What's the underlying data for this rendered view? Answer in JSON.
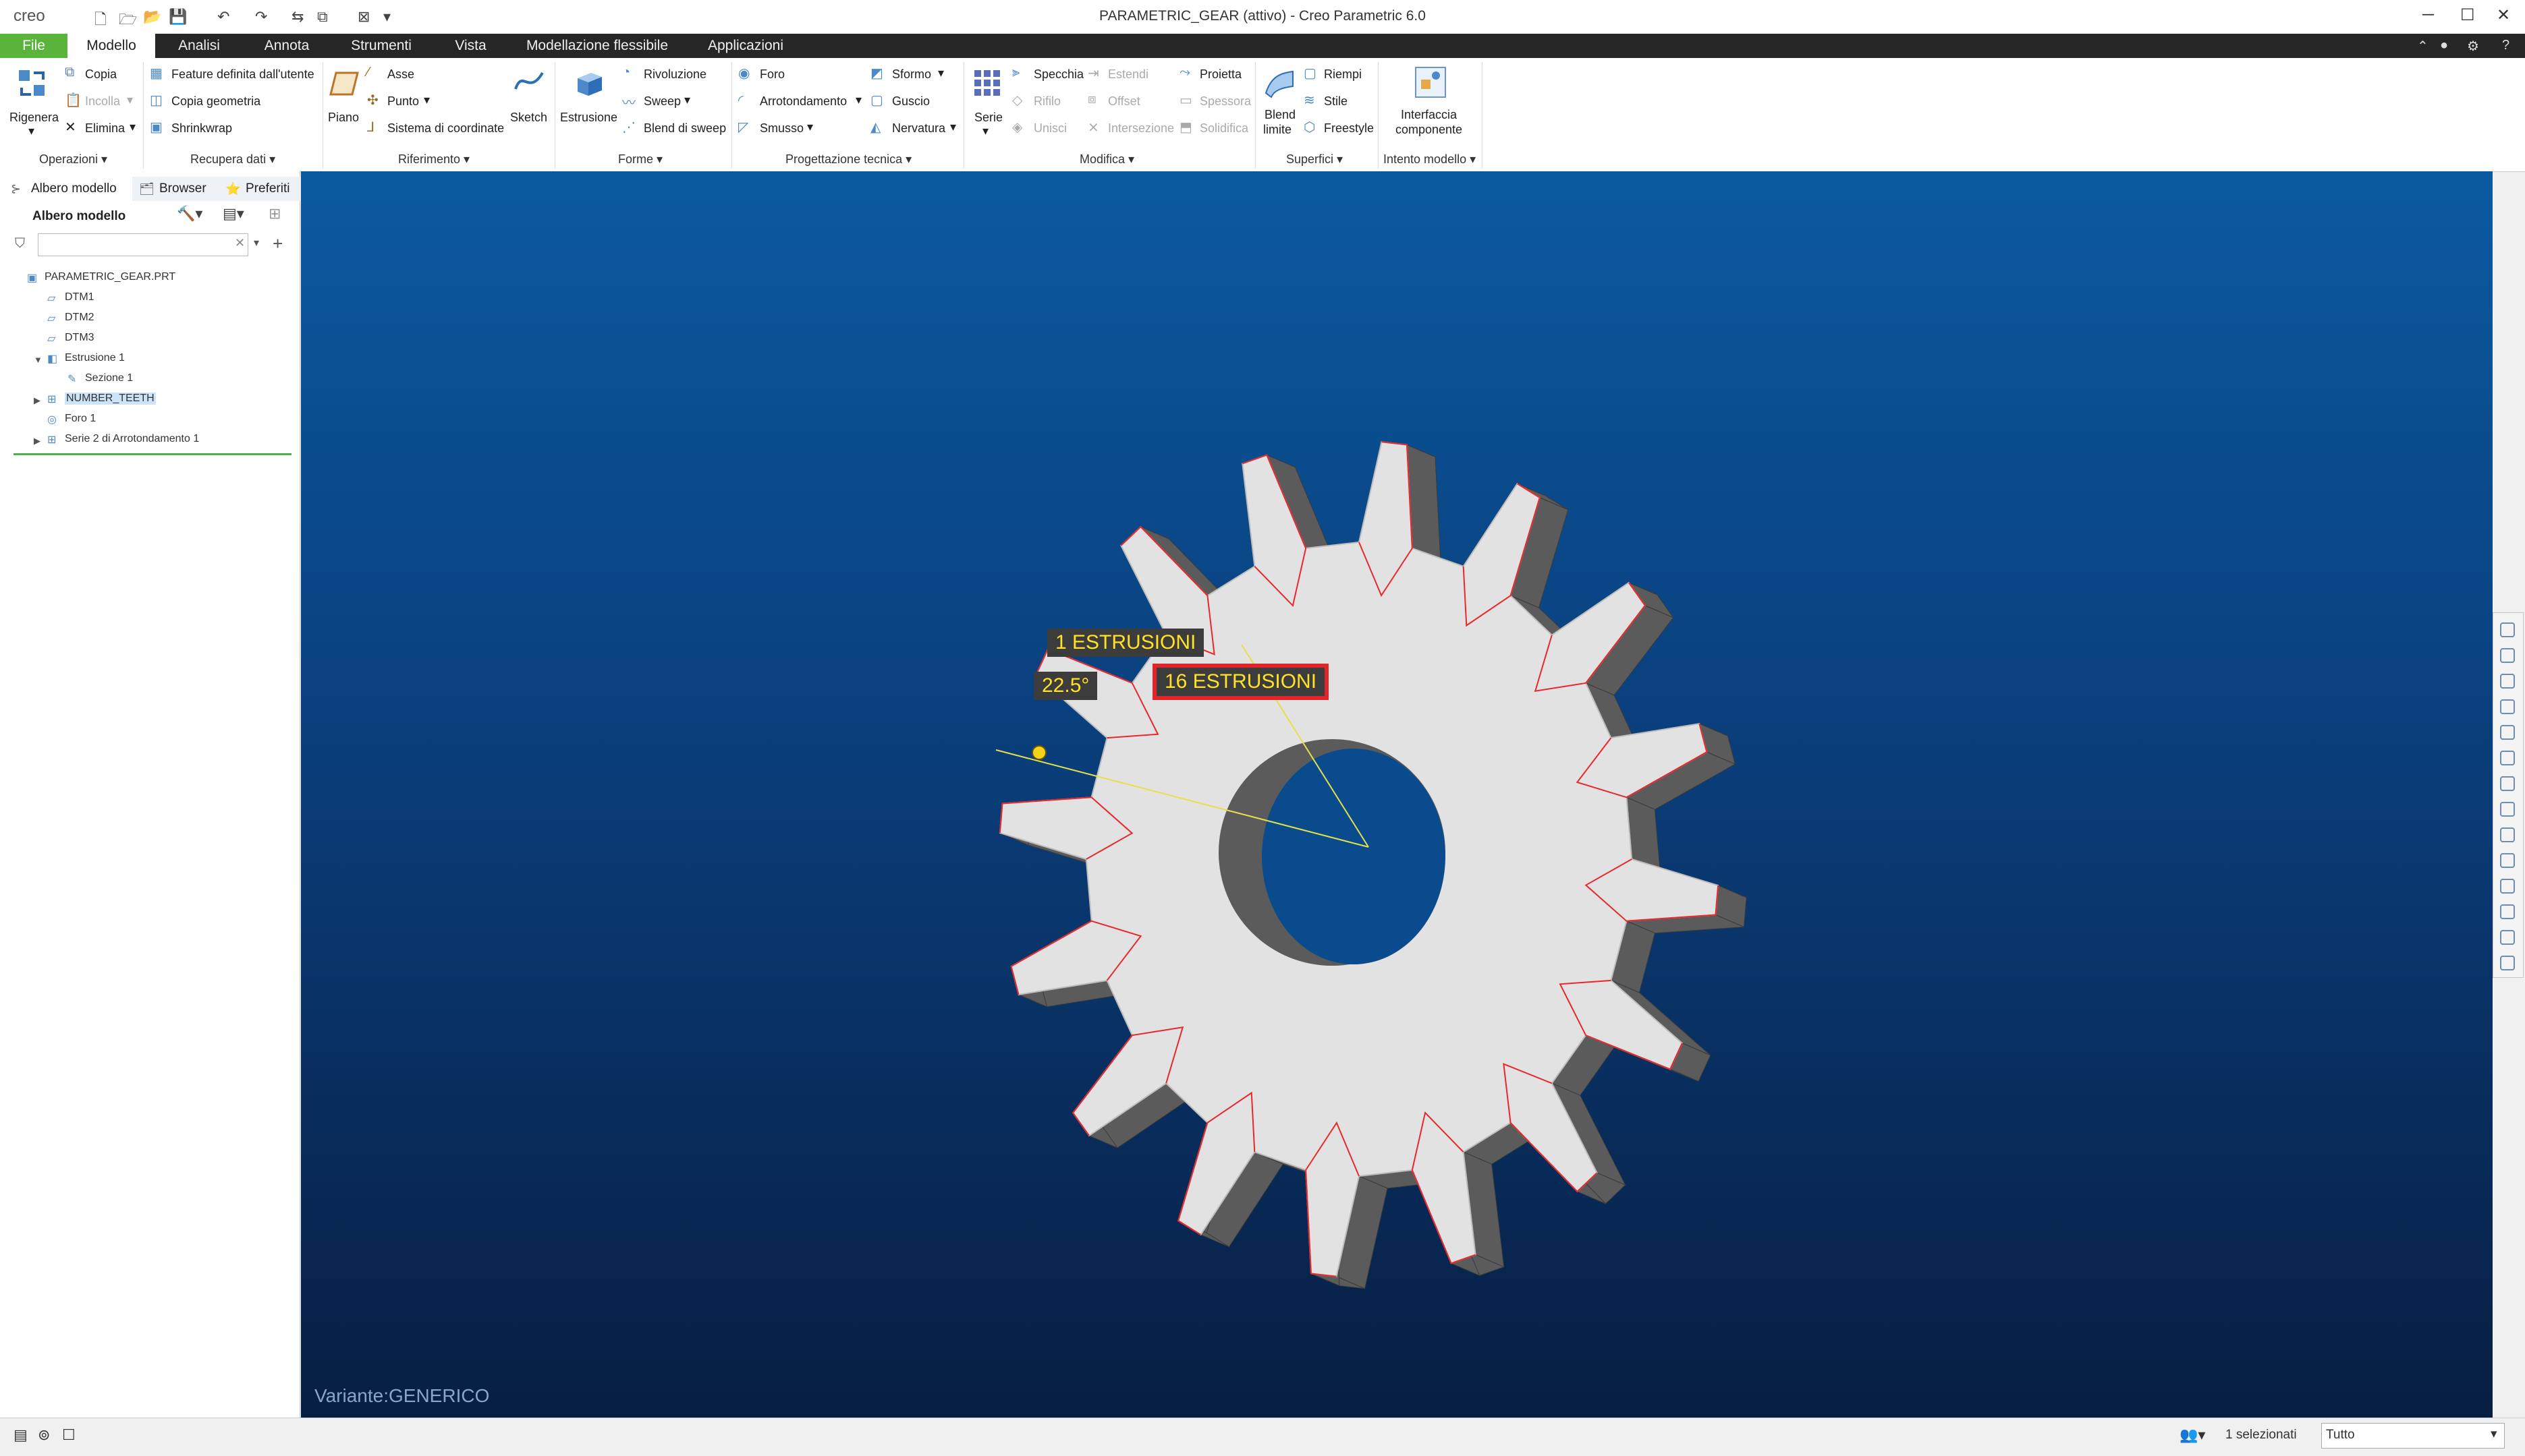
{
  "app": {
    "logo": "creo",
    "title": "PARAMETRIC_GEAR (attivo) - Creo Parametric 6.0"
  },
  "quick_access": [
    "new-icon",
    "open-icon",
    "folder-icon",
    "save-icon",
    "undo-icon",
    "redo-icon",
    "regenerate-icon",
    "window-icon",
    "close-window-icon",
    "customize-icon"
  ],
  "window_controls": [
    "minimize-icon",
    "maximize-icon",
    "close-icon"
  ],
  "menu": {
    "tabs": [
      "File",
      "Modello",
      "Analisi",
      "Annota",
      "Strumenti",
      "Vista",
      "Modellazione flessibile",
      "Applicazioni"
    ],
    "active": "Modello"
  },
  "ribbon": {
    "operazioni": {
      "rigenera": "Rigenera",
      "copia": "Copia",
      "incolla": "Incolla",
      "elimina": "Elimina",
      "group": "Operazioni"
    },
    "recupera": {
      "udf": "Feature definita dall'utente",
      "copia_geom": "Copia geometria",
      "shrinkwrap": "Shrinkwrap",
      "group": "Recupera dati"
    },
    "riferimento": {
      "piano": "Piano",
      "asse": "Asse",
      "punto": "Punto",
      "sistema": "Sistema di coordinate",
      "sketch": "Sketch",
      "group": "Riferimento"
    },
    "forme": {
      "estrusione": "Estrusione",
      "rivoluzione": "Rivoluzione",
      "sweep": "Sweep",
      "blend_sweep": "Blend di sweep",
      "group": "Forme"
    },
    "progettazione": {
      "foro": "Foro",
      "arrotondamento": "Arrotondamento",
      "smusso": "Smusso",
      "sformo": "Sformo",
      "guscio": "Guscio",
      "nervatura": "Nervatura",
      "group": "Progettazione tecnica"
    },
    "modifica": {
      "serie": "Serie",
      "specchia": "Specchia",
      "estendi": "Estendi",
      "proietta": "Proietta",
      "rifilo": "Rifilo",
      "offset": "Offset",
      "spessora": "Spessora",
      "unisci": "Unisci",
      "intersezione": "Intersezione",
      "solidifica": "Solidifica",
      "group": "Modifica"
    },
    "superfici": {
      "blend": "Blend",
      "limite": "limite",
      "riempi": "Riempi",
      "stile": "Stile",
      "freestyle": "Freestyle",
      "group": "Superfici"
    },
    "intento": {
      "interfaccia": "Interfaccia",
      "componente": "componente",
      "group": "Intento modello"
    }
  },
  "panel": {
    "tabs": [
      "Albero modello",
      "Browser",
      "Preferiti"
    ],
    "tree_title": "Albero modello",
    "tree": [
      {
        "label": "PARAMETRIC_GEAR.PRT",
        "icon": "part-icon",
        "level": 0,
        "expander": ""
      },
      {
        "label": "DTM1",
        "icon": "datum-plane-icon",
        "level": 1,
        "expander": ""
      },
      {
        "label": "DTM2",
        "icon": "datum-plane-icon",
        "level": 1,
        "expander": ""
      },
      {
        "label": "DTM3",
        "icon": "datum-plane-icon",
        "level": 1,
        "expander": ""
      },
      {
        "label": "Estrusione 1",
        "icon": "extrude-icon",
        "level": 1,
        "expander": "▼"
      },
      {
        "label": "Sezione 1",
        "icon": "sketch-icon",
        "level": 2,
        "expander": ""
      },
      {
        "label": "NUMBER_TEETH",
        "icon": "pattern-icon",
        "level": 1,
        "expander": "▶",
        "selected": true
      },
      {
        "label": "Foro 1",
        "icon": "hole-icon",
        "level": 1,
        "expander": ""
      },
      {
        "label": "Serie 2 di Arrotondamento 1",
        "icon": "pattern-icon",
        "level": 1,
        "expander": "▶"
      }
    ]
  },
  "viewport": {
    "variant": "Variante:GENERICO",
    "callouts": {
      "one": "1 ESTRUSIONI",
      "sixteen": "16 ESTRUSIONI",
      "angle": "22.5°"
    },
    "gear_teeth": 16,
    "colors": {
      "face": "#e2e2e2",
      "side": "#5b5b5b",
      "edge": "#e8282b",
      "highlight": "#e1262b"
    }
  },
  "status": {
    "selected": "1 selezionati",
    "filter": "Tutto"
  }
}
